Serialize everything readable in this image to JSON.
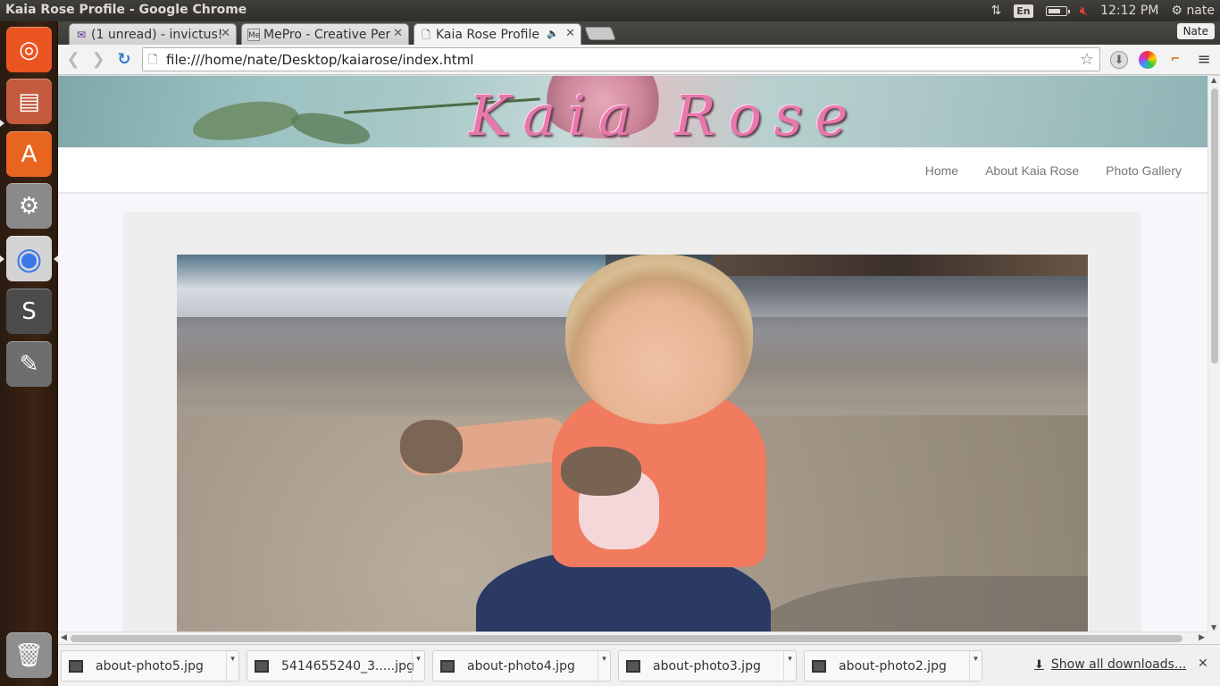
{
  "top_panel": {
    "window_title": "Kaia Rose Profile - Google Chrome",
    "keyboard_layout": "En",
    "battery_level": 0.7,
    "clock": "12:12 PM",
    "user": "nate"
  },
  "launcher": {
    "items": [
      {
        "name": "ubuntu-dash",
        "icon": "ubuntu-logo-icon",
        "glyph": "◎",
        "color": "#e95420"
      },
      {
        "name": "files",
        "icon": "file-cabinet-icon",
        "glyph": "▤",
        "color": "#c45a3e"
      },
      {
        "name": "software-center",
        "icon": "shopping-bag-icon",
        "glyph": "A",
        "color": "#e8651f"
      },
      {
        "name": "system-settings",
        "icon": "settings-wrench-icon",
        "glyph": "⚙",
        "color": "#8a8a8a"
      },
      {
        "name": "google-chrome",
        "icon": "chrome-icon",
        "glyph": "◉",
        "color": "#d4d4d4"
      },
      {
        "name": "sublime-text",
        "icon": "sublime-text-icon",
        "glyph": "S",
        "color": "#4b4b4b"
      },
      {
        "name": "gimp",
        "icon": "gimp-icon",
        "glyph": "✎",
        "color": "#6e6e6e"
      }
    ],
    "trash": {
      "icon": "trash-icon",
      "glyph": "🗑"
    }
  },
  "browser": {
    "tabs": [
      {
        "label": "(1 unread) - invictus!",
        "favicon": "mail-icon",
        "glyph": "✉",
        "active": false
      },
      {
        "label": "MePro - Creative Per",
        "favicon": "mepro-icon",
        "glyph": "Me",
        "active": false
      },
      {
        "label": "Kaia Rose Profile",
        "favicon": "page-icon",
        "glyph": "🗋",
        "active": true,
        "audio": "🔈"
      }
    ],
    "close_glyph": "✕",
    "profile_name": "Nate",
    "back_glyph": "❮",
    "forward_glyph": "❯",
    "reload_glyph": "↻",
    "page_glyph": "🗋",
    "url": "file:///home/nate/Desktop/kaiarose/index.html",
    "star_glyph": "☆",
    "menu_glyph": "≡"
  },
  "site": {
    "logo": "Kaia Rose",
    "nav": [
      "Home",
      "About Kaia Rose",
      "Photo Gallery"
    ]
  },
  "downloads": {
    "items": [
      "about-photo5.jpg",
      "5414655240_3.....jpg",
      "about-photo4.jpg",
      "about-photo3.jpg",
      "about-photo2.jpg"
    ],
    "menu_glyph": "▾",
    "show_all": "Show all downloads...",
    "arrow_glyph": "⬇",
    "close_glyph": "✕"
  }
}
